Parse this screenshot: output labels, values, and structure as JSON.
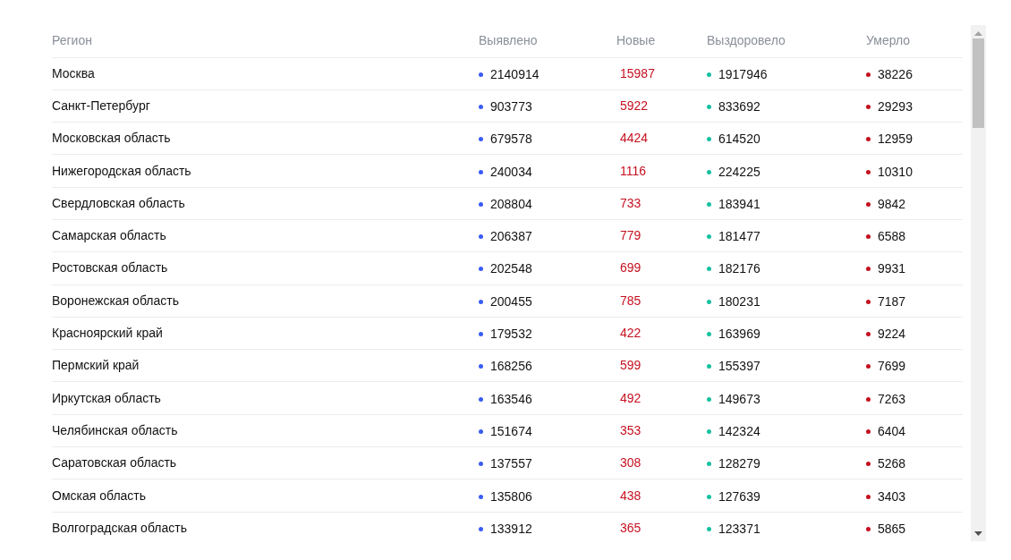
{
  "columns": [
    {
      "label": "Регион",
      "kind": "text"
    },
    {
      "label": "Выявлено",
      "kind": "dot",
      "color": "#3a5cf5"
    },
    {
      "label": "Новые",
      "kind": "accent"
    },
    {
      "label": "Выздоровело",
      "kind": "dot",
      "color": "#16c1a0"
    },
    {
      "label": "Умерло",
      "kind": "dot",
      "color": "#c5101f"
    }
  ],
  "rows": [
    [
      "Москва",
      "2140914",
      "15987",
      "1917946",
      "38226"
    ],
    [
      "Санкт-Петербург",
      "903773",
      "5922",
      "833692",
      "29293"
    ],
    [
      "Московская область",
      "679578",
      "4424",
      "614520",
      "12959"
    ],
    [
      "Нижегородская область",
      "240034",
      "1116",
      "224225",
      "10310"
    ],
    [
      "Свердловская область",
      "208804",
      "733",
      "183941",
      "9842"
    ],
    [
      "Самарская область",
      "206387",
      "779",
      "181477",
      "6588"
    ],
    [
      "Ростовская область",
      "202548",
      "699",
      "182176",
      "9931"
    ],
    [
      "Воронежская область",
      "200455",
      "785",
      "180231",
      "7187"
    ],
    [
      "Красноярский край",
      "179532",
      "422",
      "163969",
      "9224"
    ],
    [
      "Пермский край",
      "168256",
      "599",
      "155397",
      "7699"
    ],
    [
      "Иркутская область",
      "163546",
      "492",
      "149673",
      "7263"
    ],
    [
      "Челябинская область",
      "151674",
      "353",
      "142324",
      "6404"
    ],
    [
      "Саратовская область",
      "137557",
      "308",
      "128279",
      "5268"
    ],
    [
      "Омская область",
      "135806",
      "438",
      "127639",
      "3403"
    ],
    [
      "Волгоградская область",
      "133912",
      "365",
      "123371",
      "5865"
    ]
  ]
}
